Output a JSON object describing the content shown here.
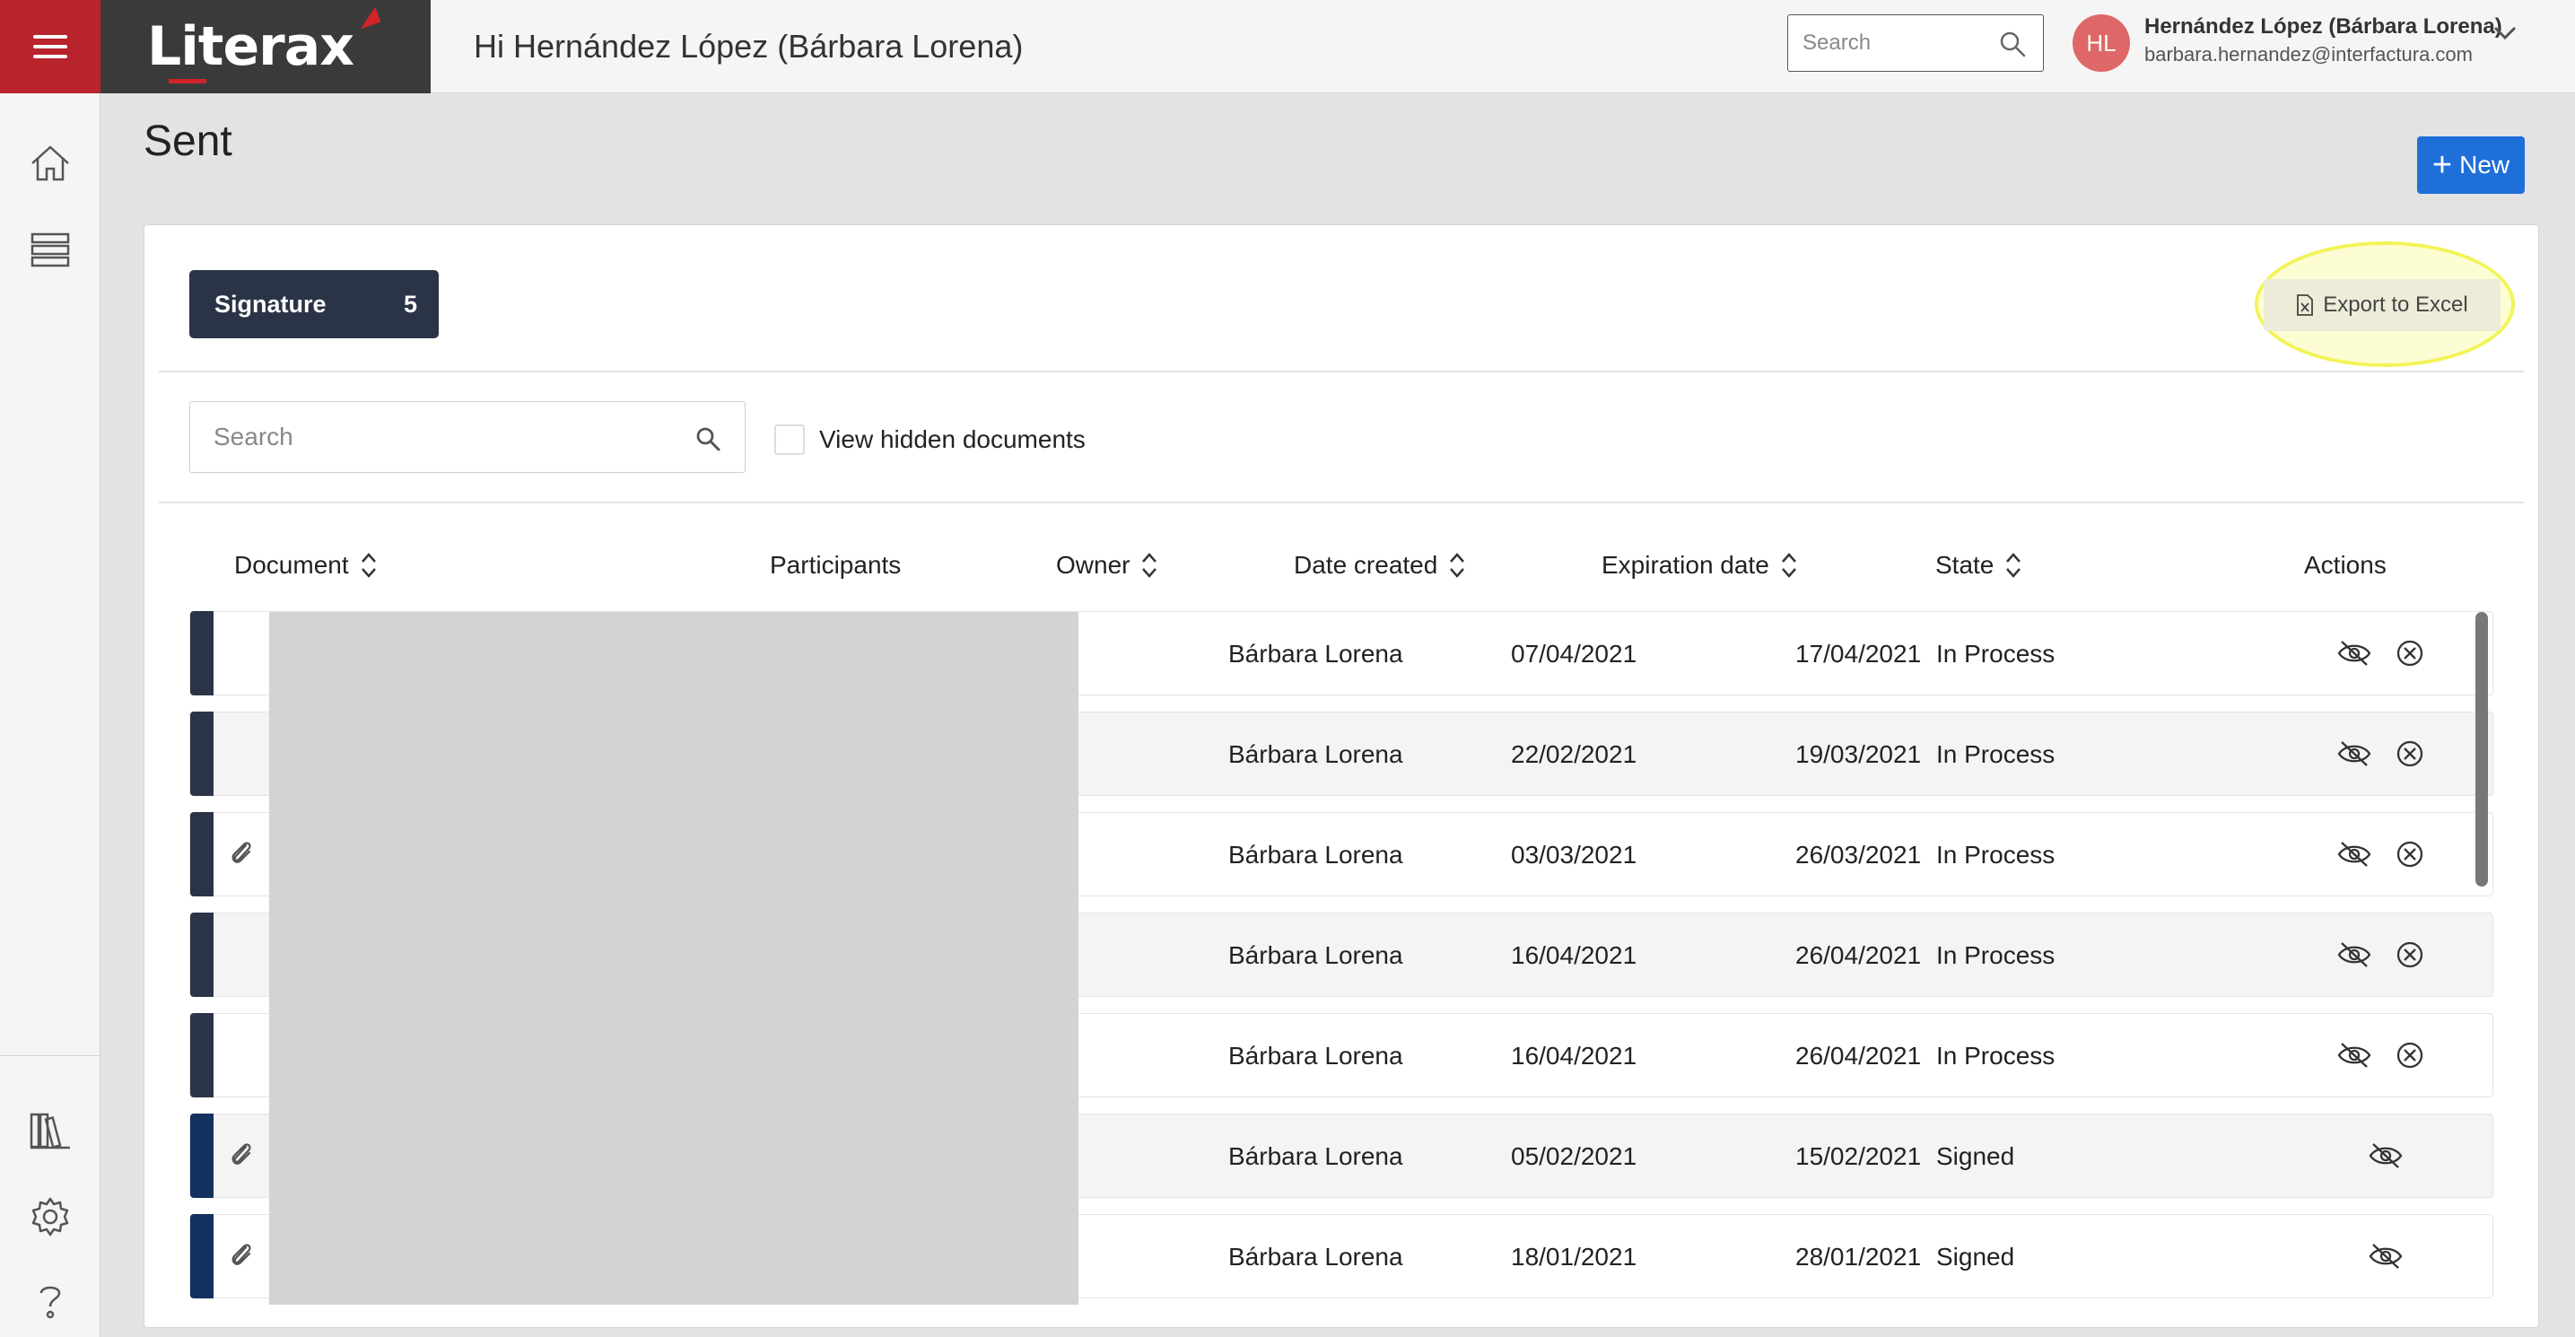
{
  "brand": {
    "logo_text": "Literax"
  },
  "header": {
    "greeting": "Hi Hernández López (Bárbara Lorena)",
    "search_placeholder": "Search",
    "user": {
      "initials": "HL",
      "name": "Hernández López (Bárbara Lorena)",
      "email": "barbara.hernandez@interfactura.com"
    }
  },
  "sidebar": {
    "icons": [
      "home-icon",
      "layers-icon",
      "library-icon",
      "gear-icon",
      "help-icon"
    ]
  },
  "page": {
    "title": "Sent",
    "new_label": "New"
  },
  "card": {
    "tab": {
      "label": "Signature",
      "count": "5"
    },
    "export_label": "Export to Excel",
    "search_placeholder": "Search",
    "view_hidden_label": "View hidden documents"
  },
  "table": {
    "columns": {
      "document": "Document",
      "participants": "Participants",
      "owner": "Owner",
      "date_created": "Date created",
      "expiration_date": "Expiration date",
      "state": "State",
      "actions": "Actions"
    },
    "rows": [
      {
        "owner": "Bárbara Lorena",
        "created": "07/04/2021",
        "expires": "17/04/2021",
        "state": "In Process",
        "attachment": false,
        "cancellable": true,
        "tag_color": "#2b3446"
      },
      {
        "owner": "Bárbara Lorena",
        "created": "22/02/2021",
        "expires": "19/03/2021",
        "state": "In Process",
        "attachment": false,
        "cancellable": true,
        "tag_color": "#2b3446"
      },
      {
        "owner": "Bárbara Lorena",
        "created": "03/03/2021",
        "expires": "26/03/2021",
        "state": "In Process",
        "attachment": true,
        "cancellable": true,
        "tag_color": "#2b3446"
      },
      {
        "owner": "Bárbara Lorena",
        "created": "16/04/2021",
        "expires": "26/04/2021",
        "state": "In Process",
        "attachment": false,
        "cancellable": true,
        "tag_color": "#2b3446"
      },
      {
        "owner": "Bárbara Lorena",
        "created": "16/04/2021",
        "expires": "26/04/2021",
        "state": "In Process",
        "attachment": false,
        "cancellable": true,
        "tag_color": "#2b3446"
      },
      {
        "owner": "Bárbara Lorena",
        "created": "05/02/2021",
        "expires": "15/02/2021",
        "state": "Signed",
        "attachment": true,
        "cancellable": false,
        "tag_color": "#12315e"
      },
      {
        "owner": "Bárbara Lorena",
        "created": "18/01/2021",
        "expires": "28/01/2021",
        "state": "Signed",
        "attachment": true,
        "cancellable": false,
        "tag_color": "#12315e"
      }
    ]
  },
  "colors": {
    "brand_red": "#b9232c",
    "primary_blue": "#1f6fd9",
    "tab_dark": "#2b3446",
    "highlight_yellow": "#f3f35a"
  }
}
